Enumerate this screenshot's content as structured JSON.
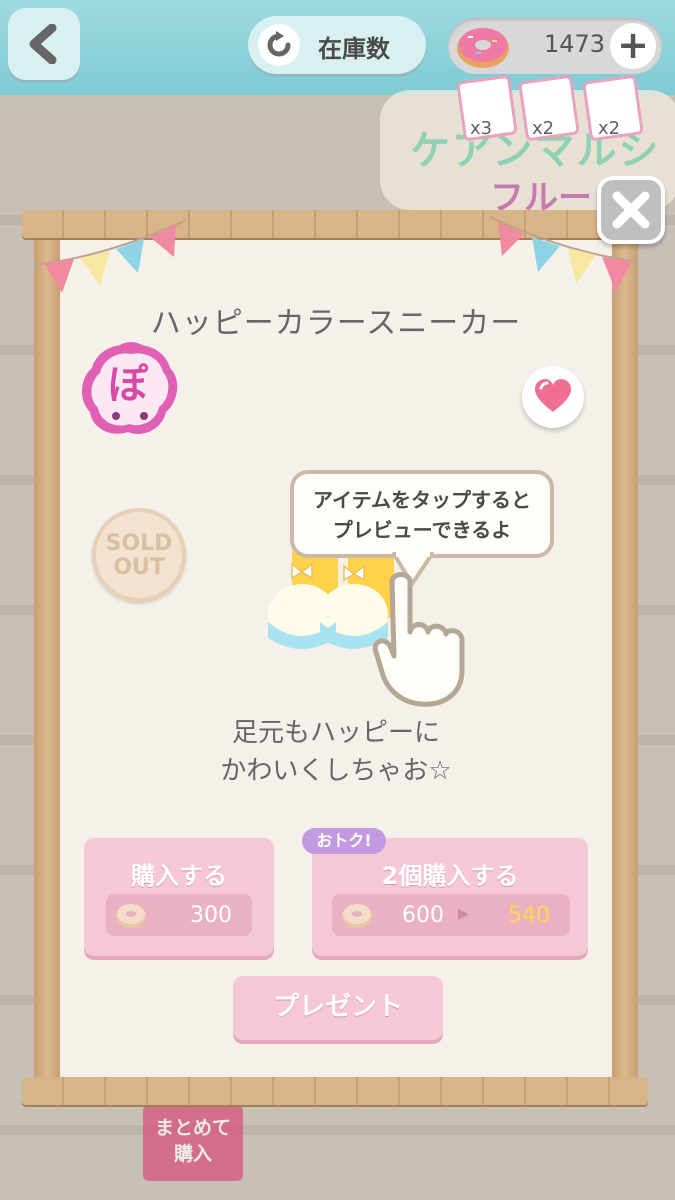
{
  "hud": {
    "stock_label": "在庫数",
    "donut_count": "1473",
    "plus": "+"
  },
  "background": {
    "banner_text": "ケアンマルシ",
    "banner_sub": "フルー",
    "card_counts": [
      "x3",
      "x2",
      "x2"
    ],
    "sold_out_side": "SOLD OUT",
    "bottom_button": [
      "まとめて",
      "購入"
    ]
  },
  "item": {
    "title": "ハッピーカラースニーカー",
    "badge_char": "ぽ",
    "sold_out": [
      "SOLD",
      "OUT"
    ],
    "description": [
      "足元もハッピーに",
      "かわいくしちゃお☆"
    ]
  },
  "tooltip": {
    "lines": [
      "アイテムをタップすると",
      "プレビューできるよ"
    ]
  },
  "actions": {
    "buy_one_label": "購入する",
    "buy_one_price": "300",
    "otoku": "おトク!",
    "buy_two_label": "2個購入する",
    "buy_two_price_old": "600",
    "buy_two_price_new": "540",
    "present_label": "プレゼント"
  },
  "colors": {
    "accent_pink": "#f6c7d4",
    "discount_yellow": "#ffd84a",
    "sky": "#9fd9e0"
  },
  "icons": [
    "back-icon",
    "refresh-icon",
    "donut-icon",
    "plus-icon",
    "close-icon",
    "heart-icon",
    "pointing-hand-icon"
  ]
}
